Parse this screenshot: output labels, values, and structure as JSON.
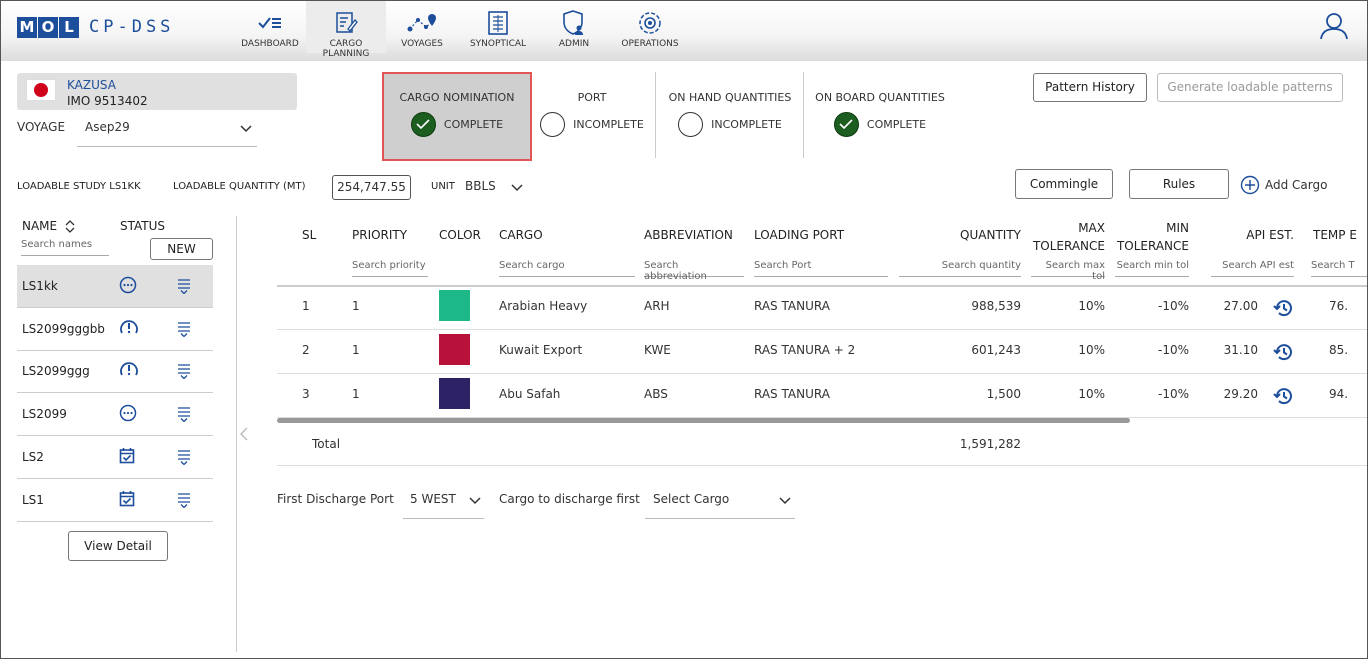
{
  "app": {
    "logo_letters": [
      "M",
      "O",
      "L"
    ],
    "name": "CP-DSS"
  },
  "nav": [
    {
      "label": "DASHBOARD",
      "icon": "dashboard-icon"
    },
    {
      "label": "CARGO PLANNING",
      "icon": "cargo-planning-icon",
      "active": true
    },
    {
      "label": "VOYAGES",
      "icon": "voyages-icon"
    },
    {
      "label": "SYNOPTICAL",
      "icon": "synoptical-icon"
    },
    {
      "label": "ADMIN",
      "icon": "admin-icon"
    },
    {
      "label": "OPERATIONS",
      "icon": "operations-icon"
    }
  ],
  "ship": {
    "name": "KAZUSA",
    "imo": "IMO 9513402"
  },
  "voyage": {
    "label": "VOYAGE",
    "value": "Asep29"
  },
  "steps": [
    {
      "title": "CARGO NOMINATION",
      "state": "COMPLETE",
      "done": true
    },
    {
      "title": "PORT",
      "state": "INCOMPLETE",
      "done": false
    },
    {
      "title": "ON HAND QUANTITIES",
      "state": "INCOMPLETE",
      "done": false
    },
    {
      "title": "ON BOARD QUANTITIES",
      "state": "COMPLETE",
      "done": true
    }
  ],
  "buttons": {
    "pattern_history": "Pattern History",
    "generate": "Generate loadable patterns",
    "commingle": "Commingle",
    "rules": "Rules",
    "add_cargo": "Add Cargo",
    "new": "NEW",
    "view_detail": "View Detail"
  },
  "loadable": {
    "study_label": "LOADABLE STUDY LS1KK",
    "qty_label": "LOADABLE QUANTITY (MT)",
    "qty_value": "254,747.55",
    "unit_label": "UNIT",
    "unit_value": "BBLS"
  },
  "sidebar": {
    "name_header": "NAME",
    "status_header": "STATUS",
    "search_placeholder": "Search names",
    "items": [
      {
        "name": "LS1kk",
        "status": "pending-icon",
        "selected": true
      },
      {
        "name": "LS2099gggbb",
        "status": "alert-icon"
      },
      {
        "name": "LS2099ggg",
        "status": "alert-icon"
      },
      {
        "name": "LS2099",
        "status": "pending-icon"
      },
      {
        "name": "LS2",
        "status": "calendar-check-icon"
      },
      {
        "name": "LS1",
        "status": "calendar-check-icon"
      }
    ]
  },
  "table": {
    "headers": {
      "sl": "SL",
      "priority": "PRIORITY",
      "color": "COLOR",
      "cargo": "CARGO",
      "abbreviation": "ABBREVIATION",
      "loading_port": "LOADING PORT",
      "quantity": "QUANTITY",
      "max_tol_1": "MAX",
      "max_tol_2": "TOLERANCE",
      "min_tol_1": "MIN",
      "min_tol_2": "TOLERANCE",
      "api": "API EST.",
      "temp": "TEMP E"
    },
    "search": {
      "priority": "Search priority",
      "cargo": "Search cargo",
      "abbreviation": "Search abbreviation",
      "port": "Search Port",
      "quantity": "Search quantity",
      "max_tol": "Search max tol",
      "min_tol": "Search min tol",
      "api": "Search API est",
      "temp": "Search T"
    },
    "rows": [
      {
        "sl": "1",
        "priority": "1",
        "color": "#1cb887",
        "cargo": "Arabian Heavy",
        "abbr": "ARH",
        "port": "RAS TANURA",
        "quantity": "988,539",
        "max_tol": "10%",
        "min_tol": "-10%",
        "api": "27.00",
        "temp": "76."
      },
      {
        "sl": "2",
        "priority": "1",
        "color": "#b8113a",
        "cargo": "Kuwait Export",
        "abbr": "KWE",
        "port": "RAS TANURA + 2",
        "quantity": "601,243",
        "max_tol": "10%",
        "min_tol": "-10%",
        "api": "31.10",
        "temp": "85."
      },
      {
        "sl": "3",
        "priority": "1",
        "color": "#2d2266",
        "cargo": "Abu Safah",
        "abbr": "ABS",
        "port": "RAS TANURA",
        "quantity": "1,500",
        "max_tol": "10%",
        "min_tol": "-10%",
        "api": "29.20",
        "temp": "94."
      }
    ],
    "total_label": "Total",
    "total_value": "1,591,282"
  },
  "bottom": {
    "first_discharge_label": "First Discharge Port",
    "first_discharge_value": "5 WEST",
    "cargo_first_label": "Cargo to discharge first",
    "cargo_first_placeholder": "Select Cargo"
  },
  "colors": {
    "brand": "#1d4e9b",
    "done": "#1b5e20",
    "highlight_border": "#e05555"
  }
}
